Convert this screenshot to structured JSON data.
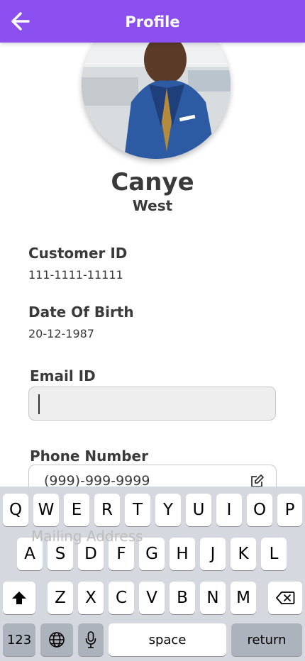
{
  "header": {
    "title": "Profile",
    "back_icon": "arrow-left-icon",
    "color": "#8b4ff0"
  },
  "profile": {
    "first_name": "Canye",
    "last_name": "West"
  },
  "fields": {
    "customer_id": {
      "label": "Customer ID",
      "value": "111-1111-11111"
    },
    "dob": {
      "label": "Date Of Birth",
      "value": "20-12-1987"
    },
    "email": {
      "label": "Email ID",
      "value": ""
    },
    "phone": {
      "label": "Phone Number",
      "value": "(999)-999-9999",
      "icon": "edit-icon"
    },
    "mailing": {
      "label": "Mailing Address"
    }
  },
  "keyboard": {
    "row1": [
      "Q",
      "W",
      "E",
      "R",
      "T",
      "Y",
      "U",
      "I",
      "O",
      "P"
    ],
    "row2": [
      "A",
      "S",
      "D",
      "F",
      "G",
      "H",
      "J",
      "K",
      "L"
    ],
    "row3": [
      "Z",
      "X",
      "C",
      "V",
      "B",
      "N",
      "M"
    ],
    "numbers": "123",
    "space": "space",
    "return": "return"
  }
}
